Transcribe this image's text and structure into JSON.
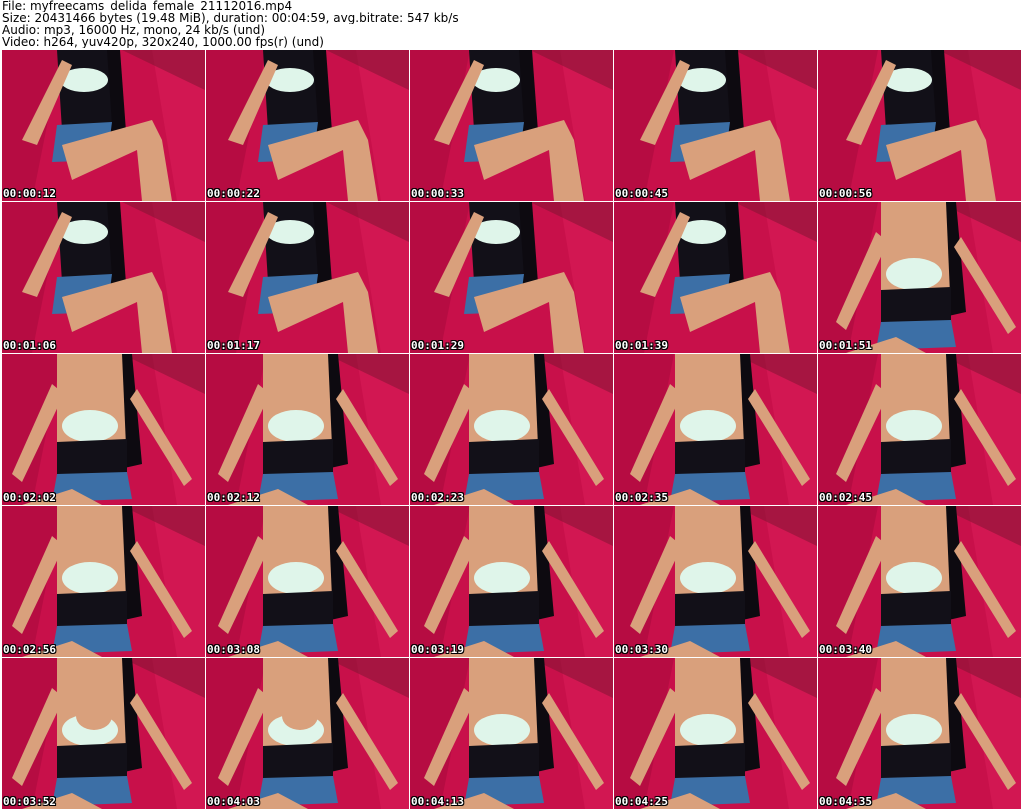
{
  "header": {
    "file_line": "File: myfreecams_delida_female_21112016.mp4",
    "size_line": "Size: 20431466 bytes (19.48 MiB), duration: 00:04:59, avg.bitrate: 547 kb/s",
    "audio_line": "Audio: mp3, 16000 Hz, mono, 24 kb/s (und)",
    "video_line": "Video: h264, yuv420p, 320x240, 1000.00 fps(r) (und)"
  },
  "colors": {
    "background": "#c8104a",
    "hair": "#0d0a10",
    "skin": "#d9a07c",
    "top": "#121018",
    "bra": "#dff5ea",
    "shorts": "#3c6fa6"
  },
  "thumbnails": [
    {
      "timestamp": "00:00:12",
      "pose": "seated-legs"
    },
    {
      "timestamp": "00:00:22",
      "pose": "seated-legs"
    },
    {
      "timestamp": "00:00:33",
      "pose": "seated-legs"
    },
    {
      "timestamp": "00:00:45",
      "pose": "seated-legs"
    },
    {
      "timestamp": "00:00:56",
      "pose": "seated-legs"
    },
    {
      "timestamp": "00:01:06",
      "pose": "seated-legs"
    },
    {
      "timestamp": "00:01:17",
      "pose": "seated-legs"
    },
    {
      "timestamp": "00:01:29",
      "pose": "seated-legs"
    },
    {
      "timestamp": "00:01:39",
      "pose": "seated-legs"
    },
    {
      "timestamp": "00:01:51",
      "pose": "arms-out"
    },
    {
      "timestamp": "00:02:02",
      "pose": "arms-out"
    },
    {
      "timestamp": "00:02:12",
      "pose": "arms-out"
    },
    {
      "timestamp": "00:02:23",
      "pose": "arms-out"
    },
    {
      "timestamp": "00:02:35",
      "pose": "arms-out"
    },
    {
      "timestamp": "00:02:45",
      "pose": "arms-out"
    },
    {
      "timestamp": "00:02:56",
      "pose": "arms-out"
    },
    {
      "timestamp": "00:03:08",
      "pose": "arms-out"
    },
    {
      "timestamp": "00:03:19",
      "pose": "arms-out"
    },
    {
      "timestamp": "00:03:30",
      "pose": "arms-out"
    },
    {
      "timestamp": "00:03:40",
      "pose": "arms-out"
    },
    {
      "timestamp": "00:03:52",
      "pose": "hand-chest"
    },
    {
      "timestamp": "00:04:03",
      "pose": "hand-chest"
    },
    {
      "timestamp": "00:04:13",
      "pose": "arms-out"
    },
    {
      "timestamp": "00:04:25",
      "pose": "arms-out"
    },
    {
      "timestamp": "00:04:35",
      "pose": "arms-out"
    }
  ]
}
